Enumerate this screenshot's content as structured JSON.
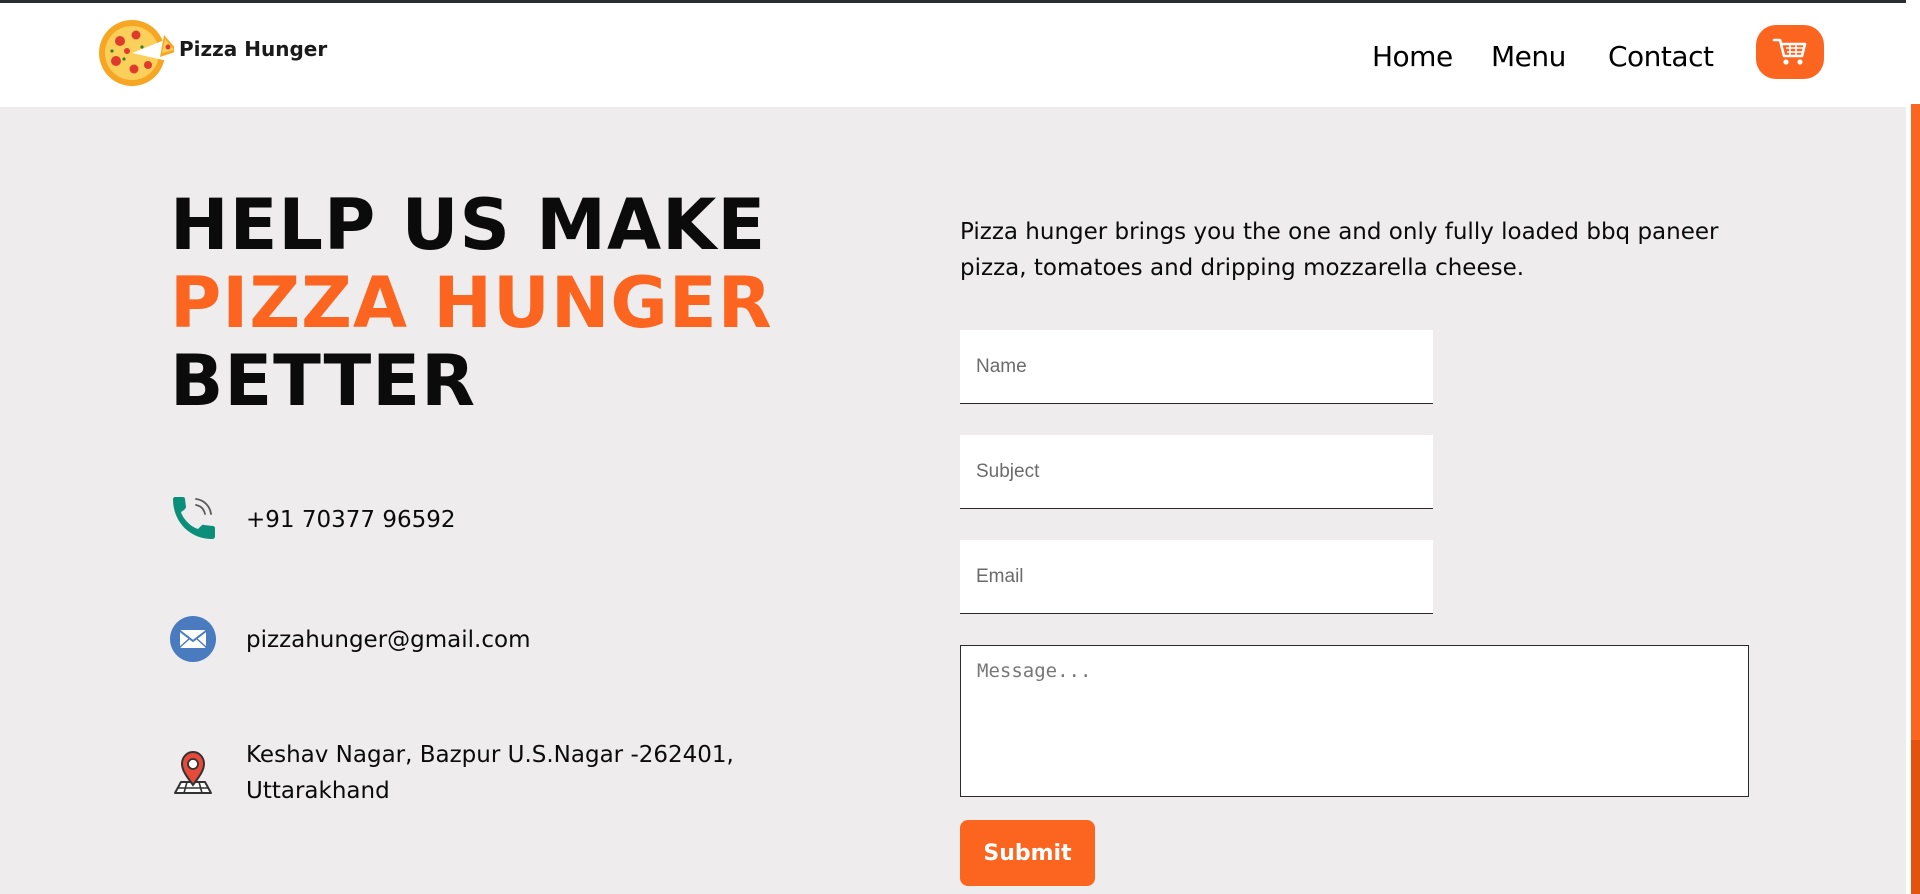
{
  "header": {
    "brand": "Pizza Hunger",
    "nav": [
      {
        "label": "Home"
      },
      {
        "label": "Menu"
      },
      {
        "label": "Contact"
      }
    ],
    "cart_icon": "shopping-cart-icon"
  },
  "hero": {
    "line1": "HELP US MAKE",
    "line2": "PIZZA HUNGER",
    "line3": "BETTER"
  },
  "contact_info": {
    "phone": "+91 70377 96592",
    "email": "pizzahunger@gmail.com",
    "address_line1": "Keshav Nagar, Bazpur U.S.Nagar -262401,",
    "address_line2": "Uttarakhand"
  },
  "form": {
    "intro": "Pizza hunger brings you the one and only fully loaded bbq paneer pizza, tomatoes and dripping mozzarella cheese.",
    "name_placeholder": "Name",
    "subject_placeholder": "Subject",
    "email_placeholder": "Email",
    "message_placeholder": "Message...",
    "submit_label": "Submit"
  },
  "colors": {
    "accent": "#fc6520",
    "page_bg": "#eeeced",
    "header_bg": "#ffffff"
  }
}
